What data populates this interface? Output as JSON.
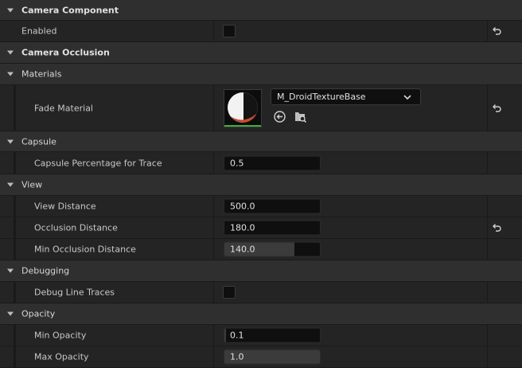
{
  "sections": {
    "camera_component": "Camera Component",
    "camera_occlusion": "Camera Occlusion",
    "materials": "Materials",
    "capsule": "Capsule",
    "view": "View",
    "debugging": "Debugging",
    "opacity": "Opacity"
  },
  "props": {
    "enabled": {
      "label": "Enabled",
      "checked": false
    },
    "fade_material": {
      "label": "Fade Material",
      "asset": "M_DroidTextureBase"
    },
    "capsule_pct": {
      "label": "Capsule Percentage for Trace",
      "value": "0.5"
    },
    "view_distance": {
      "label": "View Distance",
      "value": "500.0"
    },
    "occlusion_distance": {
      "label": "Occlusion Distance",
      "value": "180.0"
    },
    "min_occlusion_distance": {
      "label": "Min Occlusion Distance",
      "value": "140.0",
      "slider_fill": 0.73
    },
    "debug_line_traces": {
      "label": "Debug Line Traces",
      "checked": false
    },
    "min_opacity": {
      "label": "Min Opacity",
      "value": "0.1",
      "slider_fill": 0.02
    },
    "max_opacity": {
      "label": "Max Opacity",
      "value": "1.0",
      "slider_fill": 1.0
    }
  },
  "icons": {
    "reset": "reset-to-default-icon",
    "browse": "use-selected-asset-icon",
    "find": "browse-to-asset-icon",
    "dropdown": "chevron-down-icon"
  },
  "colors": {
    "bg": "#1a1a1a",
    "category": "#2f2f2f",
    "row": "#242424",
    "field": "#0f0f0f",
    "thumb_accent": "#3fae3f"
  }
}
